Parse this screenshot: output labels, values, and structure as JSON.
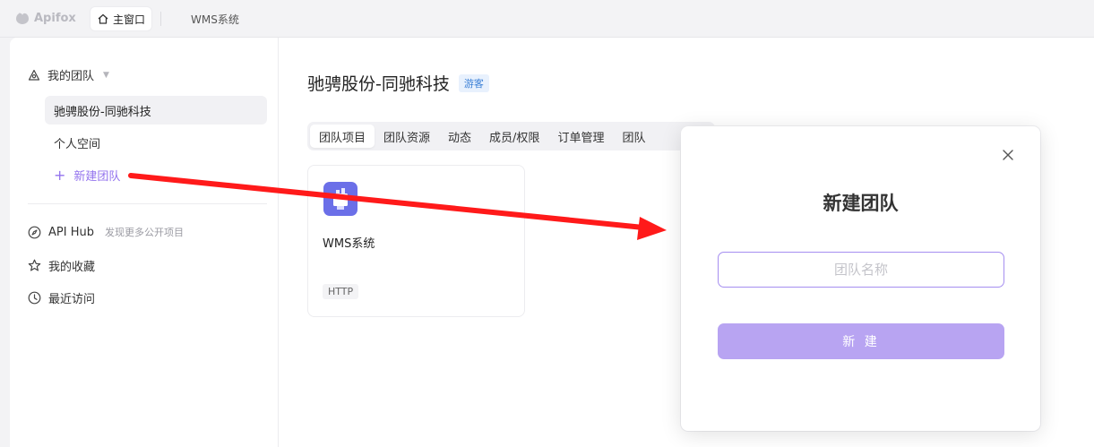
{
  "topbar": {
    "app_name": "Apifox",
    "home_tab_label": "主窗口",
    "project_tab_label": "WMS系统"
  },
  "sidebar": {
    "my_teams_label": "我的团队",
    "active_team": "驰骋股份-同驰科技",
    "personal_space": "个人空间",
    "new_team": "新建团队",
    "api_hub_label": "API Hub",
    "api_hub_hint": "发现更多公开项目",
    "favorites": "我的收藏",
    "recent": "最近访问"
  },
  "main": {
    "team_title": "驰骋股份-同驰科技",
    "role_badge": "游客",
    "tabs": [
      {
        "label": "团队项目"
      },
      {
        "label": "团队资源"
      },
      {
        "label": "动态"
      },
      {
        "label": "成员/权限"
      },
      {
        "label": "订单管理"
      },
      {
        "label": "团队"
      }
    ],
    "project_card": {
      "name": "WMS系统",
      "tag": "HTTP"
    }
  },
  "modal": {
    "title": "新建团队",
    "input_placeholder": "团队名称",
    "input_value": "",
    "submit_label": "新 建"
  },
  "colors": {
    "accent": "#9373ee",
    "button_disabled": "#b8a4f2",
    "annotation_arrow": "#ff1a1a"
  }
}
